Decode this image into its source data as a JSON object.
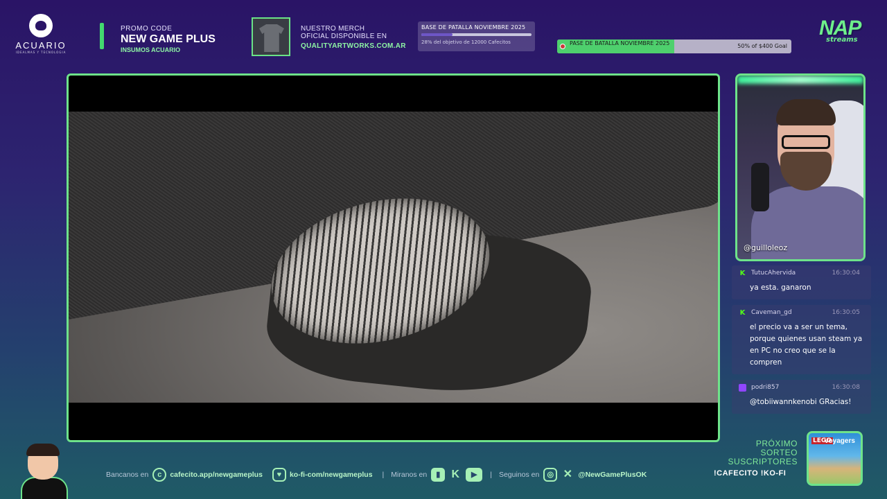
{
  "header": {
    "brand": {
      "name": "ACUARIO",
      "tagline": "IDEALMAS Y TECNOLOGIA"
    },
    "promo": {
      "label": "PROMO CODE",
      "code": "NEW GAME PLUS",
      "sub": "INSUMOS ACUARIO"
    },
    "merch": {
      "line1": "NUESTRO MERCH",
      "line2": "OFICIAL DISPONIBLE EN",
      "site": "QUALITYARTWORKS.COM.AR"
    },
    "cafecito_goal": {
      "title": "BASE DE PATALLA NOVIEMBRE 2025",
      "progress": 0.28,
      "status": "28% del objetivo de 12000 Cafecitos"
    },
    "kofi_goal": {
      "title": "PASE DE BATALLA NOVIEMBRE 2025",
      "progress": 0.5,
      "status": "50% of $400 Goal"
    },
    "logo": {
      "text": "NAP",
      "sub": "streams"
    }
  },
  "webcam": {
    "handle": "@guilloleoz"
  },
  "chat": {
    "messages": [
      {
        "platform": "kick",
        "user": "TutucAhervida",
        "time": "16:30:04",
        "text": "ya esta. ganaron"
      },
      {
        "platform": "kick",
        "user": "Caveman_gd",
        "time": "16:30:05",
        "text": "el precio va a ser un tema, porque quienes usan steam ya en PC no creo que se la compren"
      },
      {
        "platform": "twitch",
        "user": "podri857",
        "time": "16:30:08",
        "text": "@tobiiwannkenobi GRacias!"
      }
    ]
  },
  "footer": {
    "bancanos_label": "Bancanos en",
    "cafecito_link": "cafecito.app/newgameplus",
    "kofi_link": "ko-fi-com/newgameplus",
    "miranos_label": "Miranos en",
    "seguinos_label": "Seguinos en",
    "social_handle": "@NewGamePlusOK",
    "separator": "|"
  },
  "giveaway": {
    "l1": "PRÓXIMO",
    "l2": "SORTEO",
    "l3": "SUSCRIPTORES",
    "commands": "!CAFECITO  !KO-FI",
    "prize_brand": "LEGO",
    "prize_name": "voyagers"
  },
  "icons": [
    "cafecito-icon",
    "kofi-icon",
    "twitch-icon",
    "kick-icon",
    "youtube-icon",
    "instagram-icon",
    "x-icon"
  ],
  "colors": {
    "accent": "#6ee38a",
    "kick": "#53fc18",
    "twitch": "#9146ff"
  }
}
